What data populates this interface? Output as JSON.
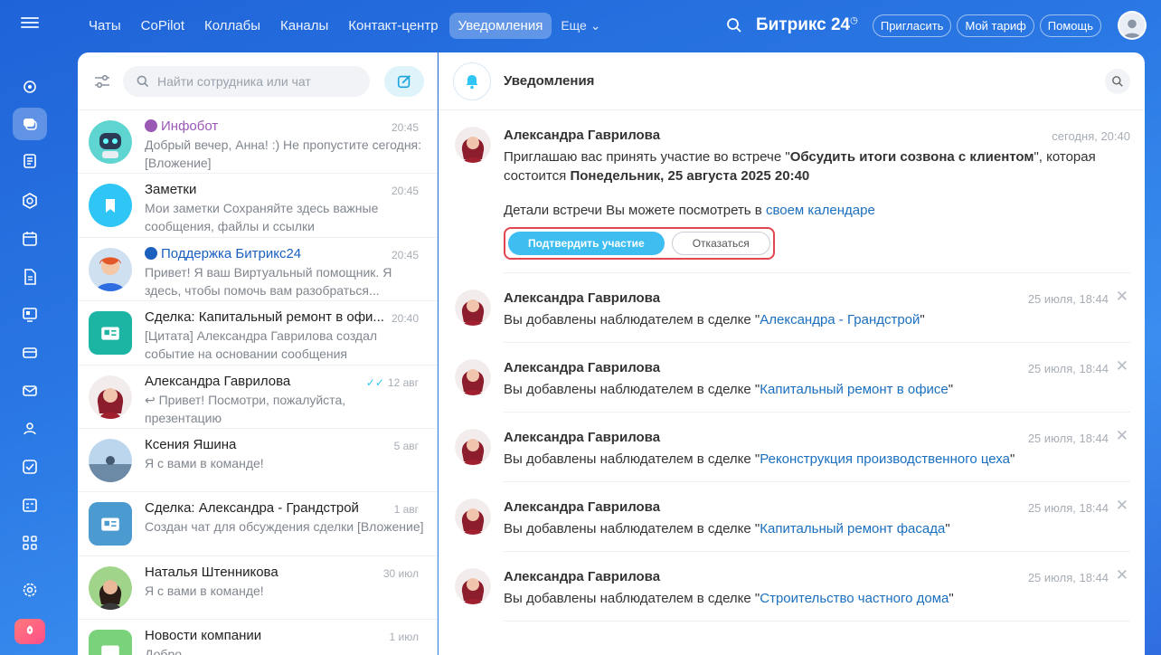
{
  "topnav": {
    "tabs": [
      "Чаты",
      "CoPilot",
      "Коллабы",
      "Каналы",
      "Контакт-центр",
      "Уведомления"
    ],
    "active_tab": "Уведомления",
    "more_label": "Еще",
    "brand": "Битрикс 24",
    "invite_label": "Пригласить",
    "tariff_label": "Мой тариф",
    "help_label": "Помощь"
  },
  "sidebar": {
    "icons": [
      "feed-icon",
      "chat-icon",
      "tasks-icon",
      "crm-icon",
      "calendar-icon",
      "docs-icon",
      "sites-icon",
      "store-icon",
      "mail-icon",
      "contacts-icon",
      "checkbox-icon",
      "planner-icon",
      "apps-icon",
      "settings-icon"
    ]
  },
  "search": {
    "placeholder": "Найти сотрудника или чат"
  },
  "chats": [
    {
      "name": "Инфобот",
      "time": "20:45",
      "message": "Добрый вечер, Анна! :) Не пропустите сегодня: [Вложение]"
    },
    {
      "name": "Заметки",
      "time": "20:45",
      "message": "Мои заметки Сохраняйте здесь важные сообщения, файлы и ссылки"
    },
    {
      "name": "Поддержка Битрикс24",
      "time": "20:45",
      "message": "Привет! Я ваш Виртуальный помощник. Я здесь, чтобы помочь вам разобраться..."
    },
    {
      "name": "Сделка: Капитальный ремонт в офи...",
      "time": "20:40",
      "message": "[Цитата] Александра Гаврилова создал событие на основании сообщения"
    },
    {
      "name": "Александра Гаврилова",
      "time": "12 авг",
      "message": "↩ Привет! Посмотри, пожалуйста, презентацию"
    },
    {
      "name": "Ксения Яшина",
      "time": "5 авг",
      "message": "Я с вами в команде!"
    },
    {
      "name": "Сделка: Александра - Грандстрой",
      "time": "1 авг",
      "message": "Создан чат для обсуждения сделки [Вложение]"
    },
    {
      "name": "Наталья Штенникова",
      "time": "30 июл",
      "message": "Я с вами в команде!"
    },
    {
      "name": "Новости компании",
      "time": "1 июл",
      "message": "Добро..."
    }
  ],
  "notifications": {
    "title": "Уведомления",
    "first": {
      "author": "Александра Гаврилова",
      "time": "сегодня, 20:40",
      "text_prefix": "Приглашаю вас принять участие во встрече \"",
      "meeting": "Обсудить итоги созвона с клиентом",
      "text_mid": "\", которая состоится ",
      "date": "Понедельник, 25 августа 2025 20:40",
      "details_prefix": "Детали встречи Вы можете посмотреть в ",
      "details_link": "своем календаре",
      "confirm_label": "Подтвердить участие",
      "decline_label": "Отказаться"
    },
    "items": [
      {
        "author": "Александра Гаврилова",
        "time": "25 июля, 18:44",
        "prefix": "Вы добавлены наблюдателем в сделке \"",
        "link": "Александра - Грандстрой",
        "suffix": "\""
      },
      {
        "author": "Александра Гаврилова",
        "time": "25 июля, 18:44",
        "prefix": "Вы добавлены наблюдателем в сделке \"",
        "link": "Капитальный ремонт в офисе",
        "suffix": "\""
      },
      {
        "author": "Александра Гаврилова",
        "time": "25 июля, 18:44",
        "prefix": "Вы добавлены наблюдателем в сделке \"",
        "link": "Реконструкция производственного цеха",
        "suffix": "\""
      },
      {
        "author": "Александра Гаврилова",
        "time": "25 июля, 18:44",
        "prefix": "Вы добавлены наблюдателем в сделке \"",
        "link": "Капитальный ремонт фасада",
        "suffix": "\""
      },
      {
        "author": "Александра Гаврилова",
        "time": "25 июля, 18:44",
        "prefix": "Вы добавлены наблюдателем в сделке \"",
        "link": "Строительство частного дома",
        "suffix": "\""
      }
    ]
  },
  "colors": {
    "accent": "#3ebdf0",
    "highlight_border": "#e2464f",
    "link": "#1b6fbf"
  }
}
